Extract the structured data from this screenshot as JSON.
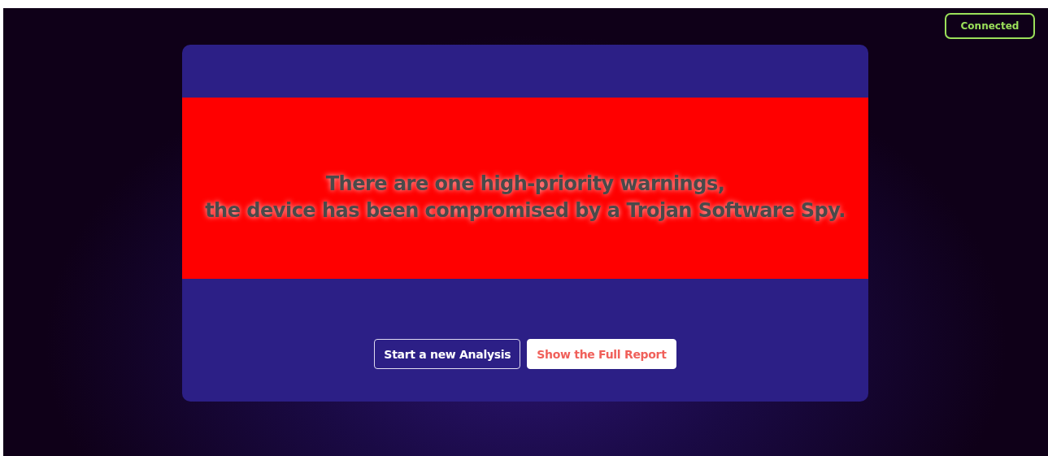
{
  "status": {
    "label": "Connected"
  },
  "alert": {
    "lines": [
      "There are one high-priority warnings,",
      "the device has been compromised by a Trojan Software Spy."
    ]
  },
  "buttons": [
    {
      "label": "Start a new Analysis",
      "kind": "outline"
    },
    {
      "label": "Show the Full Report",
      "kind": "solid"
    }
  ]
}
